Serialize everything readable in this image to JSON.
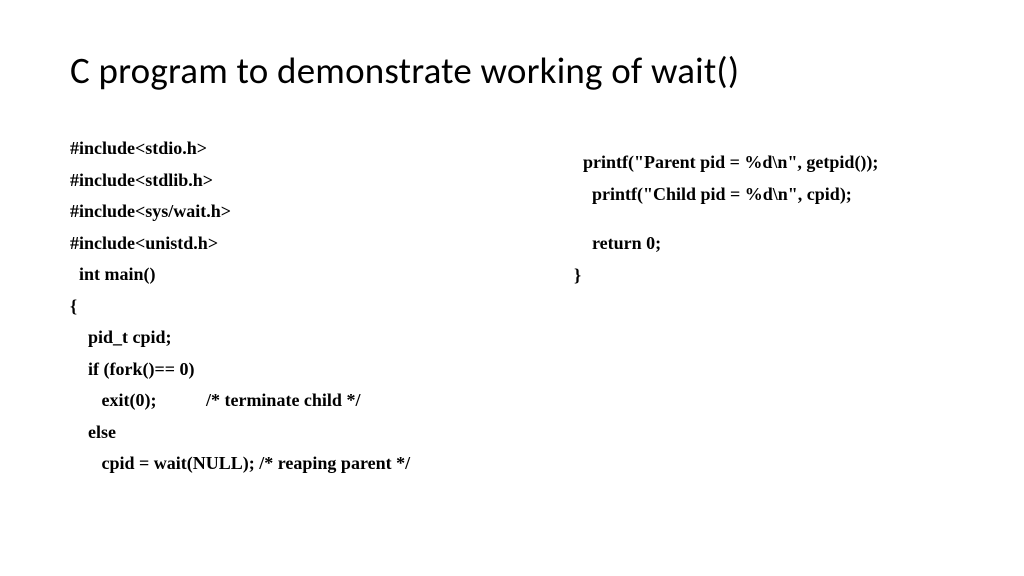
{
  "title": "C program to demonstrate working of wait()",
  "left": {
    "l0": "#include<stdio.h>",
    "l1": "#include<stdlib.h>",
    "l2": "#include<sys/wait.h>",
    "l3": "#include<unistd.h>",
    "l4": "  int main()",
    "l5": "{",
    "l6": "    pid_t cpid;",
    "l7": "    if (fork()== 0)",
    "l8": "       exit(0);           /* terminate child */",
    "l9": "    else",
    "l10": "       cpid = wait(NULL); /* reaping parent */"
  },
  "right": {
    "r0": "  printf(\"Parent pid = %d\\n\", getpid());",
    "r1": "    printf(\"Child pid = %d\\n\", cpid);",
    "r2": "    return 0;",
    "r3": "}"
  }
}
